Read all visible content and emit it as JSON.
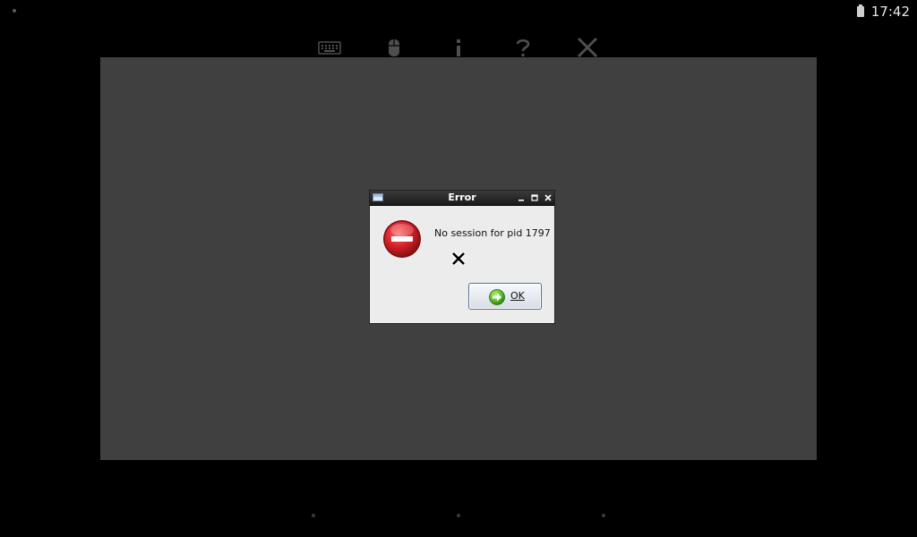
{
  "status_bar": {
    "time": "17:42",
    "battery_icon": "battery-icon"
  },
  "toolbar": {
    "buttons": [
      {
        "name": "keyboard",
        "icon": "keyboard-icon"
      },
      {
        "name": "mouse",
        "icon": "mouse-icon"
      },
      {
        "name": "info",
        "icon": "info-icon"
      },
      {
        "name": "help",
        "icon": "question-icon"
      },
      {
        "name": "disconnect",
        "icon": "close-icon"
      }
    ]
  },
  "dialog": {
    "title": "Error",
    "message": "No session for pid 1797",
    "error_icon": "error-icon",
    "ok_button": {
      "label": "OK",
      "icon": "arrow-right-icon"
    },
    "window_buttons": [
      "minimize-icon",
      "maximize-icon",
      "close-icon"
    ]
  },
  "colors": {
    "background": "#000000",
    "titlebar": "#1a1a1a",
    "dialog_body": "#ececec",
    "error_red": "#d8232a",
    "ok_icon_green": "#5fbf2f"
  }
}
